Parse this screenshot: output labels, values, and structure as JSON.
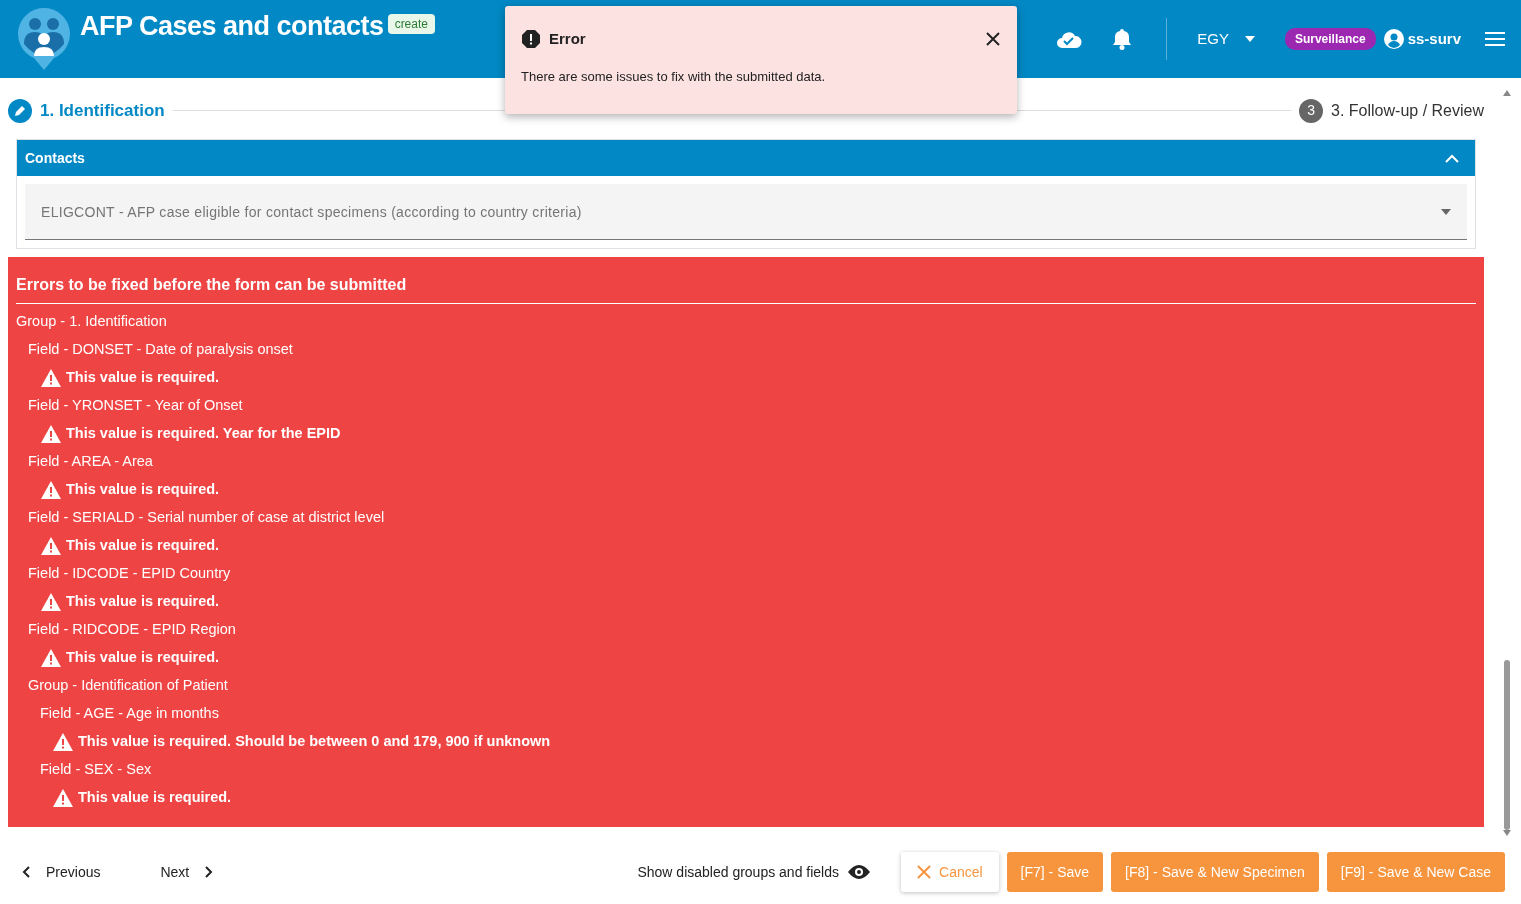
{
  "header": {
    "title": "AFP Cases and contacts",
    "badge": "create",
    "country": "EGY",
    "role": "Surveillance",
    "user": "ss-surv"
  },
  "toast": {
    "title": "Error",
    "message": "There are some issues to fix with the submitted data."
  },
  "steps": [
    {
      "label": "1. Identification",
      "selected": true
    },
    {
      "number": "3",
      "label": "3. Follow-up / Review",
      "selected": false
    }
  ],
  "section": {
    "title": "Contacts",
    "expanded": true,
    "field": {
      "placeholder": "ELIGCONT - AFP case eligible for contact specimens (according to country criteria)"
    }
  },
  "errors": {
    "title": "Errors to be fixed before the form can be submitted",
    "items": [
      {
        "label": "Group - 1. Identification",
        "children": [
          {
            "label": "Field - DONSET - Date of paralysis onset",
            "messages": [
              "This value is required."
            ]
          },
          {
            "label": "Field - YRONSET - Year of Onset",
            "messages": [
              "This value is required. Year for the EPID"
            ]
          },
          {
            "label": "Field - AREA - Area",
            "messages": [
              "This value is required."
            ]
          },
          {
            "label": "Field - SERIALD - Serial number of case at district level",
            "messages": [
              "This value is required."
            ]
          },
          {
            "label": "Field - IDCODE - EPID Country",
            "messages": [
              "This value is required."
            ]
          },
          {
            "label": "Field - RIDCODE - EPID Region",
            "messages": [
              "This value is required."
            ]
          },
          {
            "label": "Group - Identification of Patient",
            "children": [
              {
                "label": "Field - AGE - Age in months",
                "messages": [
                  "This value is required. Should be between 0 and 179, 900 if unknown"
                ]
              },
              {
                "label": "Field - SEX - Sex",
                "messages": [
                  "This value is required."
                ]
              }
            ]
          }
        ]
      }
    ]
  },
  "footer": {
    "previous": "Previous",
    "next": "Next",
    "toggle": "Show disabled groups and fields",
    "buttons": [
      {
        "kind": "cancel",
        "label": "Cancel"
      },
      {
        "kind": "primary",
        "label": "[F7] - Save"
      },
      {
        "kind": "primary",
        "label": "[F8] - Save & New Specimen"
      },
      {
        "kind": "primary",
        "label": "[F9] - Save & New Case"
      }
    ]
  }
}
